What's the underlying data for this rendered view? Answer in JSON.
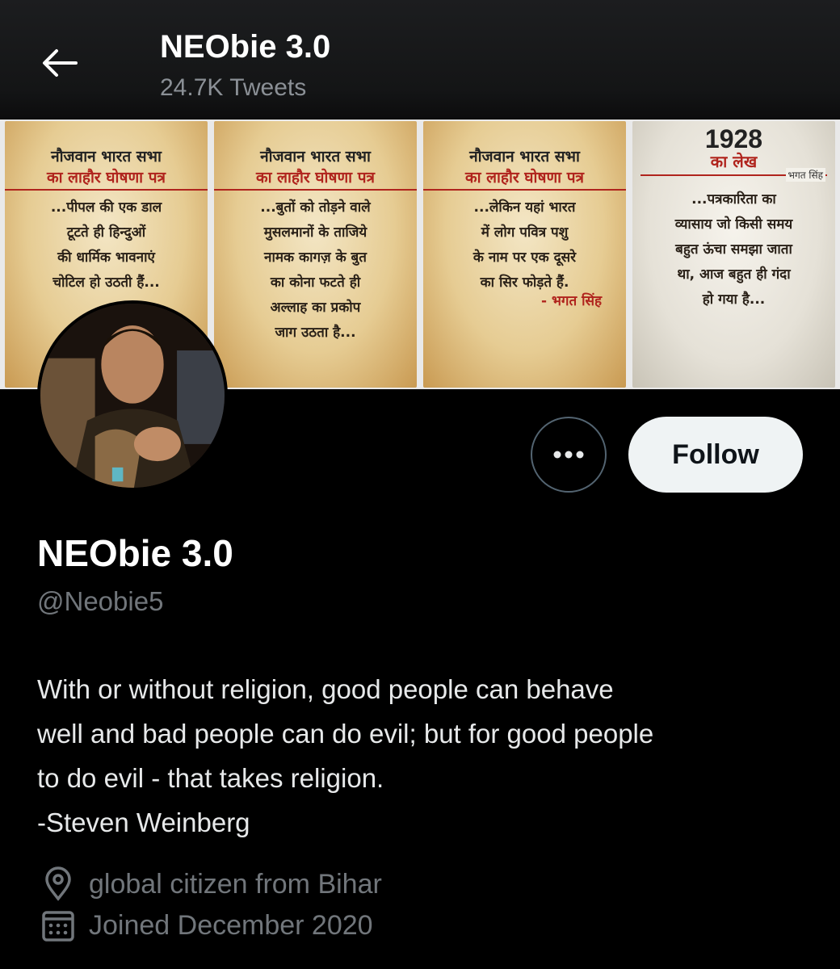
{
  "header": {
    "title": "NEObie 3.0",
    "tweet_count": "24.7K Tweets"
  },
  "banner": {
    "panels": [
      {
        "heading_line1": "नौजवान भारत सभा",
        "heading_line2": "का लाहौर घोषणा पत्र",
        "body": "...पीपल की एक डाल\nटूटते ही हिन्दुओं\nकी धार्मिक भावनाएं\nचोटिल हो उठती हैं..."
      },
      {
        "heading_line1": "नौजवान भारत सभा",
        "heading_line2": "का लाहौर घोषणा पत्र",
        "body": "...बुतों को तोड़ने वाले\nमुसलमानों के ताजिये\nनामक कागज़ के बुत\nका कोना फटते ही\nअल्लाह का प्रकोप\nजाग उठता है..."
      },
      {
        "heading_line1": "नौजवान भारत सभा",
        "heading_line2": "का लाहौर घोषणा पत्र",
        "body": "...लेकिन यहां भारत\nमें लोग पवित्र पशु\nके नाम पर एक दूसरे\nका सिर फोड़ते हैं.",
        "signature": "- भगत सिंह"
      },
      {
        "year": "1928",
        "subtitle": "का लेख",
        "signature": "भगत सिंह",
        "body": "...पत्रकारिता का\nव्यासाय जो किसी समय\nबहुत ऊंचा समझा जाता\nथा, आज बहुत ही गंदा\nहो गया है..."
      }
    ]
  },
  "profile": {
    "name": "NEObie 3.0",
    "handle": "@Neobie5",
    "bio_lines": [
      "With or without religion, good people can behave",
      "well and bad people can do evil; but for good people",
      "to do evil - that takes religion.",
      "-Steven Weinberg"
    ],
    "location": "global citizen from Bihar",
    "joined": "Joined December 2020"
  },
  "actions": {
    "follow_label": "Follow"
  },
  "icons": {
    "back": "arrow-left-icon",
    "more": "more-dots-icon",
    "location": "location-pin-icon",
    "calendar": "calendar-icon"
  },
  "colors": {
    "background": "#000000",
    "secondary_text": "#71767b",
    "follow_button_bg": "#eff3f4",
    "banner_accent": "#b0241d"
  }
}
